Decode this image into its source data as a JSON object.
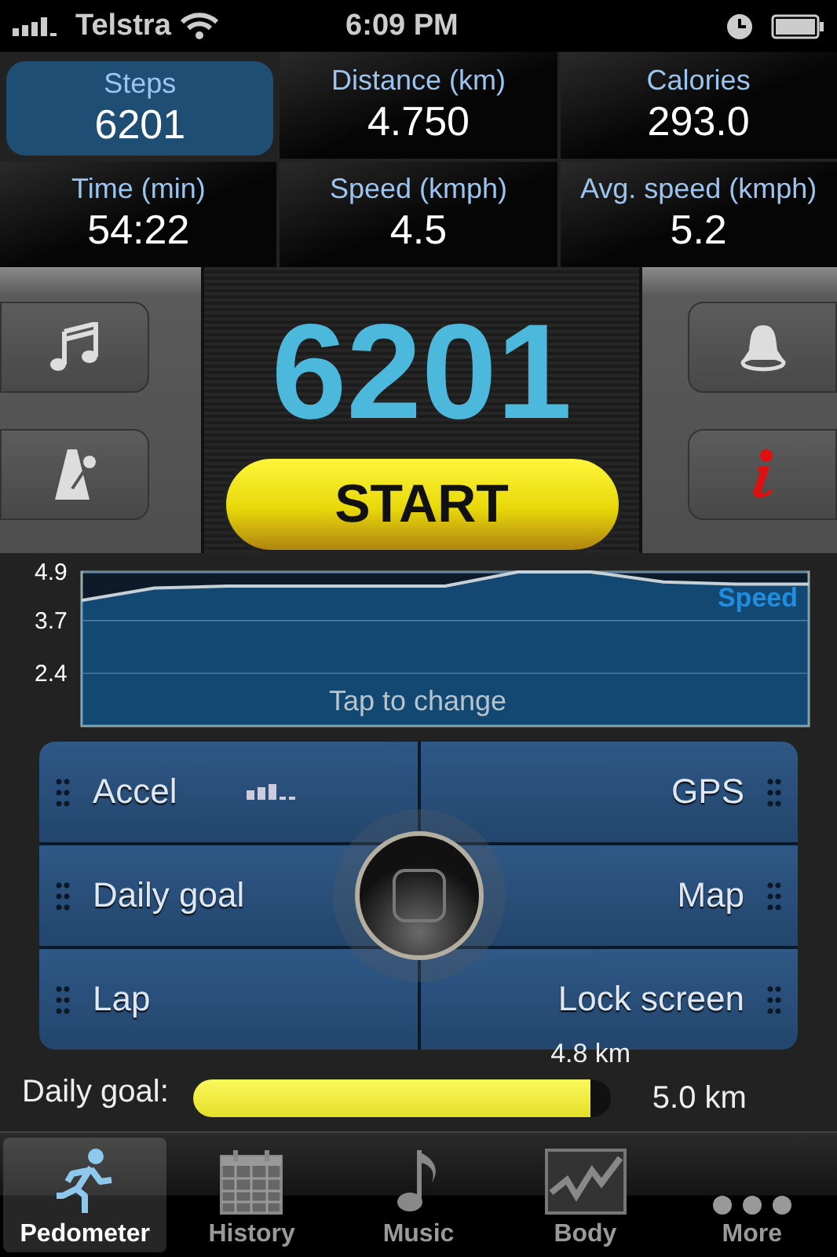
{
  "status_bar": {
    "carrier": "Telstra",
    "time": "6:09 PM"
  },
  "stats": [
    {
      "label": "Steps",
      "value": "6201",
      "selected": true
    },
    {
      "label": "Distance (km)",
      "value": "4.750",
      "selected": false
    },
    {
      "label": "Calories",
      "value": "293.0",
      "selected": false
    },
    {
      "label": "Time (min)",
      "value": "54:22",
      "selected": false
    },
    {
      "label": "Speed (kmph)",
      "value": "4.5",
      "selected": false
    },
    {
      "label": "Avg. speed (kmph)",
      "value": "5.2",
      "selected": false
    }
  ],
  "counter": "6201",
  "start_button": "START",
  "chart": {
    "hint": "Tap to change",
    "chart_data": {
      "type": "area",
      "series": [
        {
          "name": "Speed",
          "color": "#1e8ee0",
          "values": [
            4.2,
            4.5,
            4.55,
            4.55,
            4.55,
            4.55,
            4.9,
            4.9,
            4.65,
            4.6,
            4.6
          ]
        }
      ],
      "ylim": [
        1.1,
        4.9
      ],
      "yticks": [
        2.4,
        3.7,
        4.9
      ]
    }
  },
  "controls": [
    {
      "label": "Accel",
      "kind": "sensor"
    },
    {
      "label": "GPS",
      "kind": "plain"
    },
    {
      "label": "Daily goal",
      "kind": "plain"
    },
    {
      "label": "Map",
      "kind": "plain"
    },
    {
      "label": "Lap",
      "kind": "plain"
    },
    {
      "label": "Lock screen",
      "kind": "plain"
    }
  ],
  "daily_goal": {
    "label": "Daily goal:",
    "progress": "4.8 km",
    "level": 0.95,
    "target": "5.0 km"
  },
  "tabs": [
    {
      "label": "Pedometer",
      "selected": true
    },
    {
      "label": "History",
      "selected": false
    },
    {
      "label": "Music",
      "selected": false
    },
    {
      "label": "Body",
      "selected": false
    },
    {
      "label": "More",
      "selected": false
    }
  ]
}
